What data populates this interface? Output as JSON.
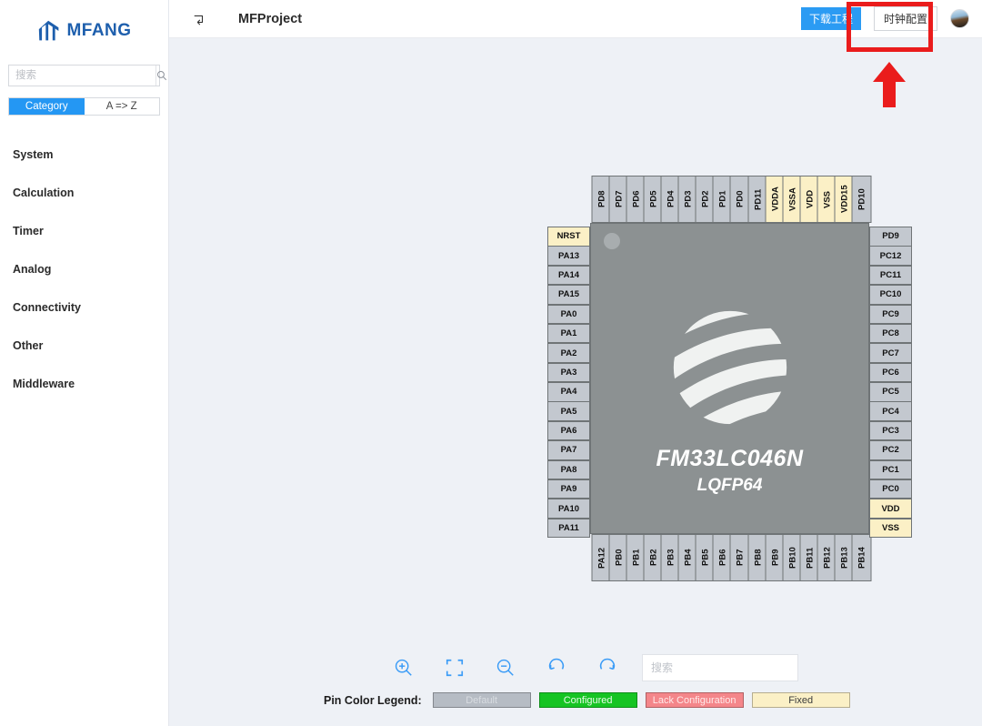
{
  "app": {
    "brand": "MFANG",
    "brand_color": "#1e5fad"
  },
  "sidebar": {
    "search": {
      "value": "",
      "placeholder": "搜索",
      "icon": "search-icon"
    },
    "toggle": {
      "left_label": "Category",
      "right_label": "A => Z",
      "active": "Category"
    },
    "items": [
      {
        "label": "System"
      },
      {
        "label": "Calculation"
      },
      {
        "label": "Timer"
      },
      {
        "label": "Analog"
      },
      {
        "label": "Connectivity"
      },
      {
        "label": "Other"
      },
      {
        "label": "Middleware"
      }
    ]
  },
  "header": {
    "back_icon": "back-arrow-icon",
    "project_title": "MFProject",
    "download_button": "下载工程",
    "clock_config_button": "时钟配置",
    "avatar": "user-avatar"
  },
  "chip": {
    "name": "FM33LC046N",
    "package": "LQFP64",
    "logo": "globe-logo",
    "pins_top": [
      {
        "label": "PD8",
        "state": "default"
      },
      {
        "label": "PD7",
        "state": "default"
      },
      {
        "label": "PD6",
        "state": "default"
      },
      {
        "label": "PD5",
        "state": "default"
      },
      {
        "label": "PD4",
        "state": "default"
      },
      {
        "label": "PD3",
        "state": "default"
      },
      {
        "label": "PD2",
        "state": "default"
      },
      {
        "label": "PD1",
        "state": "default"
      },
      {
        "label": "PD0",
        "state": "default"
      },
      {
        "label": "PD11",
        "state": "default"
      },
      {
        "label": "VDDA",
        "state": "fixed"
      },
      {
        "label": "VSSA",
        "state": "fixed"
      },
      {
        "label": "VDD",
        "state": "fixed"
      },
      {
        "label": "VSS",
        "state": "fixed"
      },
      {
        "label": "VDD15",
        "state": "fixed"
      },
      {
        "label": "PD10",
        "state": "default"
      }
    ],
    "pins_left": [
      {
        "label": "NRST",
        "state": "fixed"
      },
      {
        "label": "PA13",
        "state": "default"
      },
      {
        "label": "PA14",
        "state": "default"
      },
      {
        "label": "PA15",
        "state": "default"
      },
      {
        "label": "PA0",
        "state": "default"
      },
      {
        "label": "PA1",
        "state": "default"
      },
      {
        "label": "PA2",
        "state": "default"
      },
      {
        "label": "PA3",
        "state": "default"
      },
      {
        "label": "PA4",
        "state": "default"
      },
      {
        "label": "PA5",
        "state": "default"
      },
      {
        "label": "PA6",
        "state": "default"
      },
      {
        "label": "PA7",
        "state": "default"
      },
      {
        "label": "PA8",
        "state": "default"
      },
      {
        "label": "PA9",
        "state": "default"
      },
      {
        "label": "PA10",
        "state": "default"
      },
      {
        "label": "PA11",
        "state": "default"
      }
    ],
    "pins_right": [
      {
        "label": "PD9",
        "state": "default"
      },
      {
        "label": "PC12",
        "state": "default"
      },
      {
        "label": "PC11",
        "state": "default"
      },
      {
        "label": "PC10",
        "state": "default"
      },
      {
        "label": "PC9",
        "state": "default"
      },
      {
        "label": "PC8",
        "state": "default"
      },
      {
        "label": "PC7",
        "state": "default"
      },
      {
        "label": "PC6",
        "state": "default"
      },
      {
        "label": "PC5",
        "state": "default"
      },
      {
        "label": "PC4",
        "state": "default"
      },
      {
        "label": "PC3",
        "state": "default"
      },
      {
        "label": "PC2",
        "state": "default"
      },
      {
        "label": "PC1",
        "state": "default"
      },
      {
        "label": "PC0",
        "state": "default"
      },
      {
        "label": "VDD",
        "state": "fixed"
      },
      {
        "label": "VSS",
        "state": "fixed"
      }
    ],
    "pins_bottom": [
      {
        "label": "PA12",
        "state": "default"
      },
      {
        "label": "PB0",
        "state": "default"
      },
      {
        "label": "PB1",
        "state": "default"
      },
      {
        "label": "PB2",
        "state": "default"
      },
      {
        "label": "PB3",
        "state": "default"
      },
      {
        "label": "PB4",
        "state": "default"
      },
      {
        "label": "PB5",
        "state": "default"
      },
      {
        "label": "PB6",
        "state": "default"
      },
      {
        "label": "PB7",
        "state": "default"
      },
      {
        "label": "PB8",
        "state": "default"
      },
      {
        "label": "PB9",
        "state": "default"
      },
      {
        "label": "PB10",
        "state": "default"
      },
      {
        "label": "PB11",
        "state": "default"
      },
      {
        "label": "PB12",
        "state": "default"
      },
      {
        "label": "PB13",
        "state": "default"
      },
      {
        "label": "PB14",
        "state": "default"
      }
    ]
  },
  "toolbar": {
    "buttons": [
      {
        "icon": "zoom-in-icon"
      },
      {
        "icon": "fit-screen-icon"
      },
      {
        "icon": "zoom-out-icon"
      },
      {
        "icon": "rotate-left-icon"
      },
      {
        "icon": "rotate-right-icon"
      }
    ],
    "search": {
      "value": "",
      "placeholder": "搜索",
      "icon": "search-icon"
    }
  },
  "legend": {
    "title": "Pin Color Legend:",
    "entries": [
      {
        "label": "Default",
        "color": "#b6bcc4"
      },
      {
        "label": "Configured",
        "color": "#16c423"
      },
      {
        "label": "Lack Configuration",
        "color": "#f4868a"
      },
      {
        "label": "Fixed",
        "color": "#fbf0c6"
      }
    ]
  },
  "annotation": {
    "highlight_color": "#ea1c1c",
    "target": "时钟配置"
  }
}
